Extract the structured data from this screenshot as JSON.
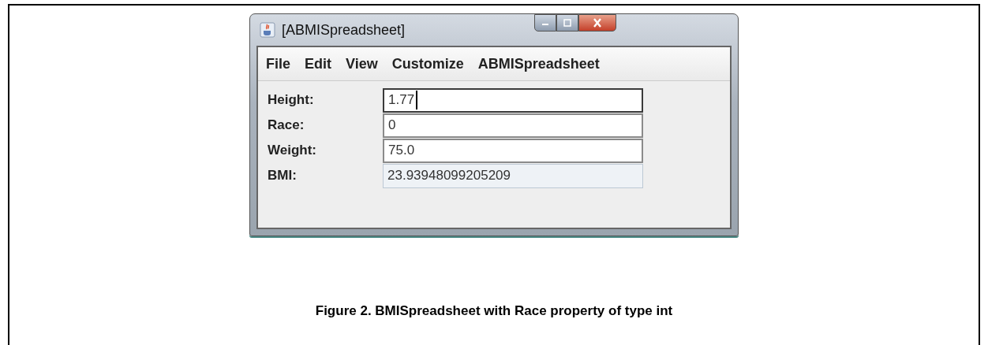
{
  "window": {
    "title": "[ABMISpreadsheet]"
  },
  "menu": [
    "File",
    "Edit",
    "View",
    "Customize",
    "ABMISpreadsheet"
  ],
  "fields": [
    {
      "label": "Height:",
      "value": "1.77",
      "kind": "input",
      "focused": true
    },
    {
      "label": "Race:",
      "value": "0",
      "kind": "input",
      "focused": false
    },
    {
      "label": "Weight:",
      "value": "75.0",
      "kind": "input",
      "focused": false
    },
    {
      "label": "BMI:",
      "value": "23.93948099205209",
      "kind": "readonly"
    }
  ],
  "caption": "Figure 2. BMISpreadsheet with Race property of type int"
}
